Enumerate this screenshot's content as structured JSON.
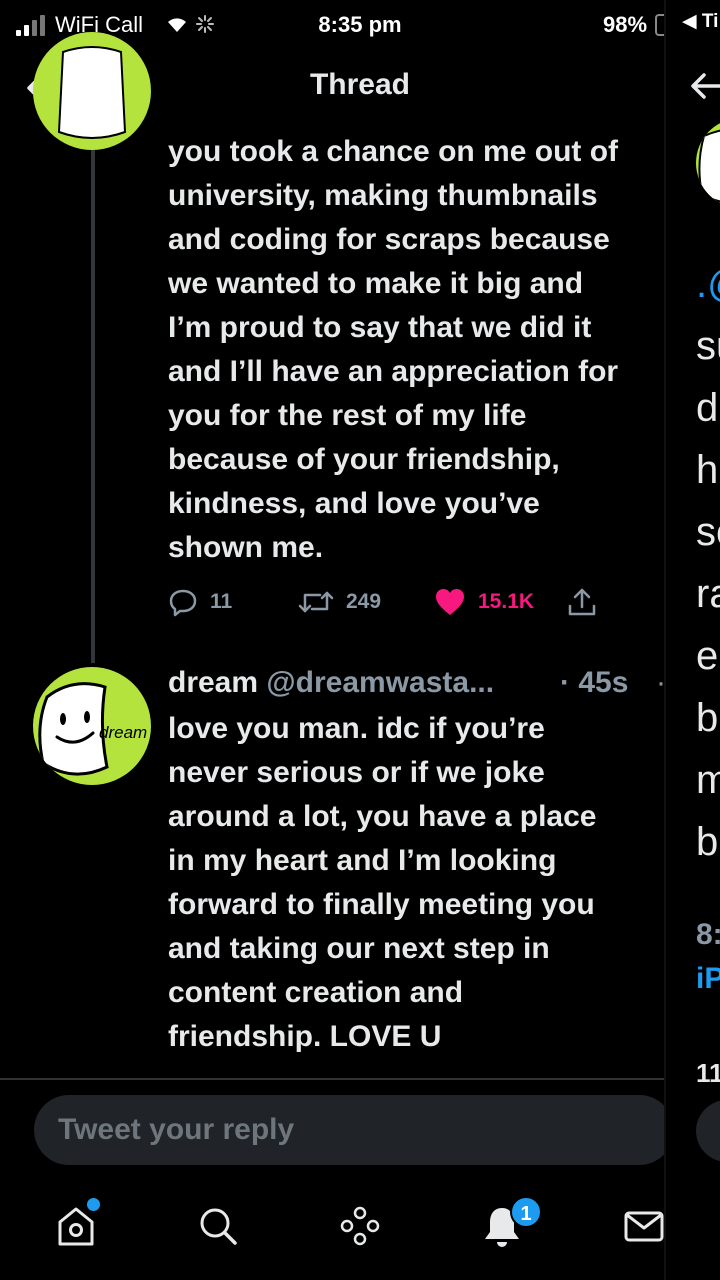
{
  "status_bar": {
    "carrier": "WiFi Call",
    "time": "8:35 pm",
    "battery": "98%"
  },
  "header": {
    "title": "Thread"
  },
  "parent_tweet": {
    "lines": [
      "you took a chance on me out of",
      "university, making thumbnails",
      "and coding for scraps because",
      "we wanted to make it big and",
      "I’m proud to say that we did it",
      "and I’ll have an appreciation for",
      "you for the rest of my life",
      "because of your friendship,",
      "kindness, and love you’ve",
      "shown me."
    ],
    "replies": "11",
    "retweets": "249",
    "likes": "15.1K"
  },
  "reply_tweet": {
    "name": "dream",
    "handle": "@dreamwasta...",
    "time": "· 45s",
    "avatar_text": "dream",
    "lines": [
      "love you man. idc if you’re",
      "never serious or if we joke",
      "around a lot, you have a place",
      "in my heart and I’m looking",
      "forward to finally meeting you",
      "and taking our next step in",
      "content creation and",
      "friendship. LOVE U"
    ]
  },
  "composer": {
    "placeholder": "Tweet your reply"
  },
  "bottom_nav": {
    "items": [
      "home-icon",
      "search-icon",
      "spaces-icon",
      "notifications-icon",
      "messages-icon"
    ],
    "notification_badge": "1"
  },
  "peek_pane": {
    "status_text": "◀ Ti",
    "letters": [
      ".@",
      "su",
      "d",
      "h",
      "sc",
      "ra",
      "e",
      "b",
      "m",
      "b"
    ],
    "meta": "8:",
    "link": "iP",
    "count": "11"
  },
  "colors": {
    "accent": "#1d9bf0",
    "like": "#f91880",
    "avatar_green": "#b4e33d",
    "background": "#000000"
  }
}
